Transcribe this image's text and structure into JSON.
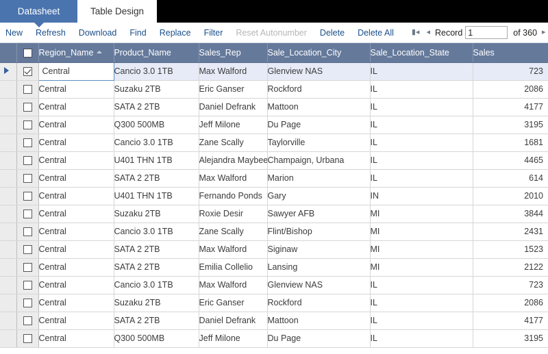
{
  "tabs": [
    {
      "label": "Datasheet",
      "active": true
    },
    {
      "label": "Table Design",
      "active": false
    }
  ],
  "toolbar": {
    "new_label": "New",
    "refresh_label": "Refresh",
    "download_label": "Download",
    "find_label": "Find",
    "replace_label": "Replace",
    "filter_label": "Filter",
    "reset_autonumber_label": "Reset Autonumber",
    "delete_label": "Delete",
    "delete_all_label": "Delete All",
    "record_label": "Record",
    "record_value": "1",
    "record_total": "of 360",
    "first_icon": "first-page-icon",
    "prev_icon": "previous-record-icon",
    "next_icon": "next-record-icon",
    "last_icon": "last-page-icon"
  },
  "grid": {
    "sort_column": "Region_Name",
    "sort_direction": "asc",
    "columns": [
      "Region_Name",
      "Product_Name",
      "Sales_Rep",
      "Sale_Location_City",
      "Sale_Location_State",
      "Sales"
    ],
    "rows": [
      {
        "selected": true,
        "region": "Central",
        "product": "Cancio 3.0 1TB",
        "rep": "Max Walford",
        "city": "Glenview NAS",
        "state": "IL",
        "sales": "723"
      },
      {
        "selected": false,
        "region": "Central",
        "product": "Suzaku 2TB",
        "rep": "Eric Ganser",
        "city": "Rockford",
        "state": "IL",
        "sales": "2086"
      },
      {
        "selected": false,
        "region": "Central",
        "product": "SATA 2 2TB",
        "rep": "Daniel Defrank",
        "city": "Mattoon",
        "state": "IL",
        "sales": "4177"
      },
      {
        "selected": false,
        "region": "Central",
        "product": "Q300 500MB",
        "rep": "Jeff Milone",
        "city": "Du Page",
        "state": "IL",
        "sales": "3195"
      },
      {
        "selected": false,
        "region": "Central",
        "product": "Cancio 3.0 1TB",
        "rep": "Zane Scally",
        "city": "Taylorville",
        "state": "IL",
        "sales": "1681"
      },
      {
        "selected": false,
        "region": "Central",
        "product": "U401 THN 1TB",
        "rep": "Alejandra Maybee",
        "city": "Champaign, Urbana",
        "state": "IL",
        "sales": "4465"
      },
      {
        "selected": false,
        "region": "Central",
        "product": "SATA 2 2TB",
        "rep": "Max Walford",
        "city": "Marion",
        "state": "IL",
        "sales": "614"
      },
      {
        "selected": false,
        "region": "Central",
        "product": "U401 THN 1TB",
        "rep": "Fernando Ponds",
        "city": "Gary",
        "state": "IN",
        "sales": "2010"
      },
      {
        "selected": false,
        "region": "Central",
        "product": "Suzaku 2TB",
        "rep": "Roxie Desir",
        "city": "Sawyer AFB",
        "state": "MI",
        "sales": "3844"
      },
      {
        "selected": false,
        "region": "Central",
        "product": "Cancio 3.0 1TB",
        "rep": "Zane Scally",
        "city": "Flint/Bishop",
        "state": "MI",
        "sales": "2431"
      },
      {
        "selected": false,
        "region": "Central",
        "product": "SATA 2 2TB",
        "rep": "Max Walford",
        "city": "Siginaw",
        "state": "MI",
        "sales": "1523"
      },
      {
        "selected": false,
        "region": "Central",
        "product": "SATA 2 2TB",
        "rep": "Emilia Collelio",
        "city": "Lansing",
        "state": "MI",
        "sales": "2122"
      },
      {
        "selected": false,
        "region": "Central",
        "product": "Cancio 3.0 1TB",
        "rep": "Max Walford",
        "city": "Glenview NAS",
        "state": "IL",
        "sales": "723"
      },
      {
        "selected": false,
        "region": "Central",
        "product": "Suzaku 2TB",
        "rep": "Eric Ganser",
        "city": "Rockford",
        "state": "IL",
        "sales": "2086"
      },
      {
        "selected": false,
        "region": "Central",
        "product": "SATA 2 2TB",
        "rep": "Daniel Defrank",
        "city": "Mattoon",
        "state": "IL",
        "sales": "4177"
      },
      {
        "selected": false,
        "region": "Central",
        "product": "Q300 500MB",
        "rep": "Jeff Milone",
        "city": "Du Page",
        "state": "IL",
        "sales": "3195"
      }
    ]
  },
  "colors": {
    "tab_active": "#4a74ae",
    "header_blue": "#65799b",
    "link_blue": "#1b4f8a",
    "selected_row": "#e6ebf7",
    "gutter_gray": "#ececec"
  }
}
